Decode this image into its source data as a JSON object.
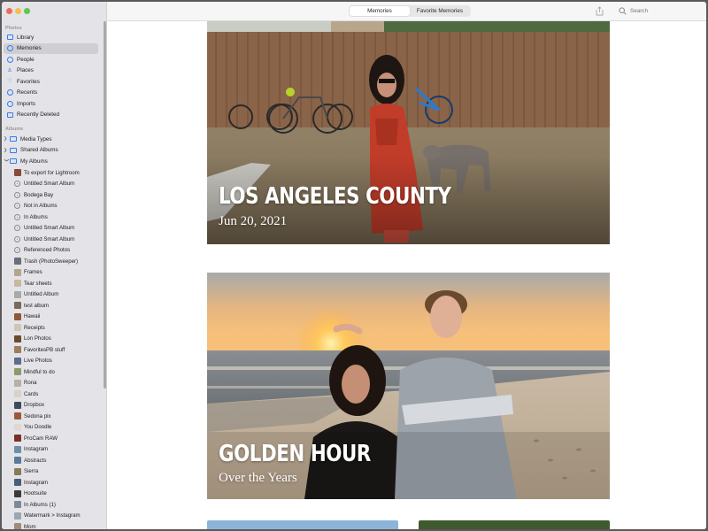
{
  "sidebar": {
    "photos_section": "Photos",
    "albums_section": "Albums",
    "library_items": [
      {
        "label": "Library"
      },
      {
        "label": "Memories"
      },
      {
        "label": "People"
      },
      {
        "label": "Places"
      },
      {
        "label": "Favorites"
      },
      {
        "label": "Recents"
      },
      {
        "label": "Imports"
      },
      {
        "label": "Recently Deleted"
      }
    ],
    "album_groups": [
      {
        "label": "Media Types"
      },
      {
        "label": "Shared Albums"
      },
      {
        "label": "My Albums"
      }
    ],
    "albums": [
      {
        "label": "To export for Lightroom",
        "kind": "photo",
        "color": "#8a4a3c"
      },
      {
        "label": "Untitled Smart Album",
        "kind": "smart"
      },
      {
        "label": "Bodega Bay",
        "kind": "smart"
      },
      {
        "label": "Not in Albums",
        "kind": "smart"
      },
      {
        "label": "In Albums",
        "kind": "smart"
      },
      {
        "label": "Untitled Smart Album",
        "kind": "smart"
      },
      {
        "label": "Untitled Smart Album",
        "kind": "smart"
      },
      {
        "label": "Referenced Photos",
        "kind": "smart"
      },
      {
        "label": "Trash (PhotoSweeper)",
        "kind": "photo",
        "color": "#6c6f78"
      },
      {
        "label": "Frames",
        "kind": "photo",
        "color": "#b4a58c"
      },
      {
        "label": "Tear sheets",
        "kind": "photo",
        "color": "#c9b8a0"
      },
      {
        "label": "Untitled Album",
        "kind": "photo",
        "color": "#a9a9a9"
      },
      {
        "label": "test album",
        "kind": "photo",
        "color": "#7a6a58"
      },
      {
        "label": "Hawaii",
        "kind": "photo",
        "color": "#8c5a3a"
      },
      {
        "label": "Receipts",
        "kind": "photo",
        "color": "#cfc6b8"
      },
      {
        "label": "Lon Photos",
        "kind": "photo",
        "color": "#6a4a2e"
      },
      {
        "label": "FavoritesPB stuff",
        "kind": "photo",
        "color": "#9a7e5e"
      },
      {
        "label": "Live Photos",
        "kind": "photo",
        "color": "#5a6e8a"
      },
      {
        "label": "Mindful to do",
        "kind": "photo",
        "color": "#8a9c6a"
      },
      {
        "label": "Rona",
        "kind": "photo",
        "color": "#b8b0a6"
      },
      {
        "label": "Cards",
        "kind": "photo",
        "color": "#d8d2c8"
      },
      {
        "label": "Dropbox",
        "kind": "photo",
        "color": "#3e4a5c"
      },
      {
        "label": "Sedona pix",
        "kind": "photo",
        "color": "#9a5a3a"
      },
      {
        "label": "You Doodle",
        "kind": "photo",
        "color": "#e0d8ce"
      },
      {
        "label": "ProCam RAW",
        "kind": "photo",
        "color": "#7a2e28"
      },
      {
        "label": "Instagram",
        "kind": "photo",
        "color": "#6e8ea8"
      },
      {
        "label": "Abstracts",
        "kind": "photo",
        "color": "#5a7a9a"
      },
      {
        "label": "Sierra",
        "kind": "photo",
        "color": "#8a7a5a"
      },
      {
        "label": "Instagram",
        "kind": "photo",
        "color": "#4a5e7a"
      },
      {
        "label": "Hootsuite",
        "kind": "photo",
        "color": "#3a3a3a"
      },
      {
        "label": "In Albums (1)",
        "kind": "photo",
        "color": "#7a8a9a"
      },
      {
        "label": "Watermark > Instagram",
        "kind": "photo",
        "color": "#9aa6b0"
      },
      {
        "label": "Mom",
        "kind": "photo",
        "color": "#a08a7a"
      }
    ]
  },
  "toolbar": {
    "tabs": [
      {
        "label": "Memories"
      },
      {
        "label": "Favorite Memories"
      }
    ],
    "search_placeholder": "Search"
  },
  "memories": [
    {
      "title": "LOS ANGELES COUNTY",
      "subtitle": "Jun 20, 2021"
    },
    {
      "title": "GOLDEN HOUR",
      "subtitle": "Over the Years"
    }
  ]
}
